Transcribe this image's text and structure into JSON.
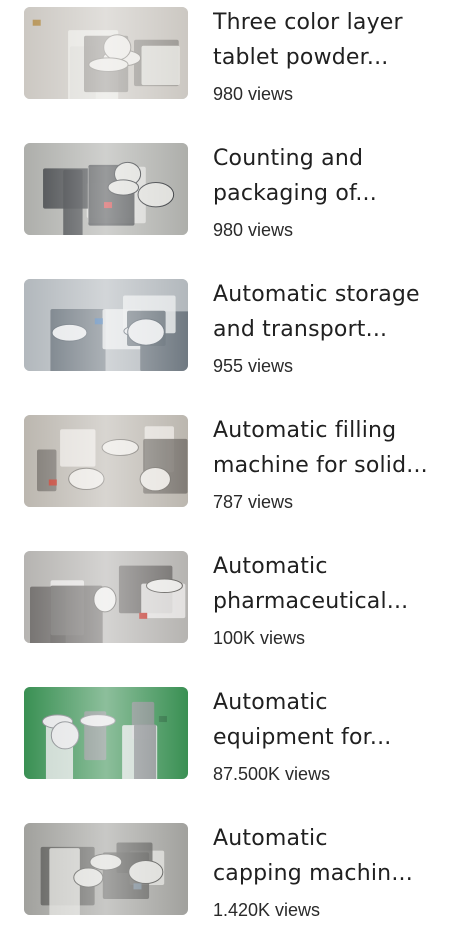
{
  "videos": [
    {
      "title_line1": "Three color layer",
      "title_line2": "tablet powder...",
      "views": "980 views",
      "thumb_icon": "tablet-press-machine-photo",
      "palette": {
        "bg": "#c9c5bf",
        "a": "#e8e6e2",
        "b": "#8d8a85",
        "c": "#b38f4f"
      }
    },
    {
      "title_line1": "Counting and",
      "title_line2": "packaging of...",
      "views": "980 views",
      "thumb_icon": "counting-packaging-machine-photo",
      "palette": {
        "bg": "#a9aaa6",
        "a": "#dcdcd8",
        "b": "#2c2f33",
        "c": "#c9383a"
      }
    },
    {
      "title_line1": "Automatic storage",
      "title_line2": "and transport...",
      "views": "955 views",
      "thumb_icon": "storage-transport-machine-photo",
      "palette": {
        "bg": "#aeb4b9",
        "a": "#e5e7e9",
        "b": "#5c6670",
        "c": "#3a6ea8"
      }
    },
    {
      "title_line1": "Automatic filling",
      "title_line2": "machine for solid...",
      "views": "787 views",
      "thumb_icon": "filling-machine-photo",
      "palette": {
        "bg": "#b8b3ab",
        "a": "#e7e4df",
        "b": "#6e6a64",
        "c": "#c0392b"
      }
    },
    {
      "title_line1": "Automatic",
      "title_line2": "pharmaceutical...",
      "views": "100K views",
      "thumb_icon": "pharmaceutical-tanks-photo",
      "palette": {
        "bg": "#b2b0ad",
        "a": "#e9e8e6",
        "b": "#5f5d5a",
        "c": "#c23b32"
      }
    },
    {
      "title_line1": "Automatic",
      "title_line2": "equipment for...",
      "views": "87.500K views",
      "thumb_icon": "coating-equipment-photo",
      "palette": {
        "bg": "#2f8a4a",
        "a": "#e3e4e5",
        "b": "#7b7f83",
        "c": "#1f6b37"
      }
    },
    {
      "title_line1": "Automatic",
      "title_line2": "capping machin...",
      "views": "1.420K views",
      "thumb_icon": "capping-machine-photo",
      "palette": {
        "bg": "#9c9c98",
        "a": "#dadad6",
        "b": "#4d4d4a",
        "c": "#6f7f8c"
      }
    }
  ]
}
